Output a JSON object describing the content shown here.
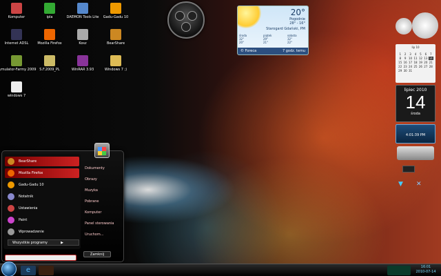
{
  "desktop_icons": [
    {
      "label": "Komputer",
      "color": "#c44",
      "x": 0,
      "y": 0
    },
    {
      "label": "ipla",
      "color": "#3a3",
      "x": 1,
      "y": 0
    },
    {
      "label": "DAEMON Tools Lite",
      "color": "#58c",
      "x": 2,
      "y": 0
    },
    {
      "label": "Gadu-Gadu 10",
      "color": "#e90",
      "x": 3,
      "y": 0
    },
    {
      "label": "Internet ADSL",
      "color": "#335",
      "x": 0,
      "y": 1
    },
    {
      "label": "Mozilla Firefox",
      "color": "#e60",
      "x": 1,
      "y": 1
    },
    {
      "label": "Kosz",
      "color": "#aaa",
      "x": 2,
      "y": 1
    },
    {
      "label": "BearShare",
      "color": "#c82",
      "x": 3,
      "y": 1
    },
    {
      "label": "Symulator-Farmy 2009",
      "color": "#793",
      "x": 0,
      "y": 2
    },
    {
      "label": "S.F.2009_PL",
      "color": "#cb6",
      "x": 1,
      "y": 2
    },
    {
      "label": "WinRAR 3.93",
      "color": "#839",
      "x": 2,
      "y": 2
    },
    {
      "label": "Windows 7 ;)",
      "color": "#db5",
      "x": 3,
      "y": 2
    },
    {
      "label": "windows 7",
      "color": "#eee",
      "x": 0,
      "y": 3
    }
  ],
  "weather": {
    "temp": "20°",
    "condition": "Pogodnie",
    "range": "28° - 16°",
    "location": "Starogard Gdański, PM",
    "days": [
      {
        "name": "środa",
        "hi": "32°",
        "lo": "20°"
      },
      {
        "name": "piątek",
        "hi": "29°",
        "lo": "21°"
      },
      {
        "name": "sobota",
        "hi": "32°",
        "lo": "22°"
      }
    ],
    "source": "© Foreca",
    "updated": "7 godz. temu"
  },
  "start_menu": {
    "items": [
      "BearShare",
      "Mozilla Firefox",
      "Gadu-Gadu 10",
      "Notatnik",
      "Ustawienia",
      "Paint",
      "Wprowadzenie"
    ],
    "all_programs": "Wszystkie programy",
    "right_items": [
      "Dokumenty",
      "Obrazy",
      "Muzyka",
      "Pobrane",
      "Komputer",
      "Panel sterowania",
      "Uruchom..."
    ],
    "shutdown": "Zamknij"
  },
  "calendar": {
    "month": "lip 10",
    "days": [
      "1",
      "2",
      "3",
      "4",
      "5",
      "6",
      "7",
      "8",
      "9",
      "10",
      "11",
      "12",
      "13",
      "14",
      "15",
      "16",
      "17",
      "18",
      "19",
      "20",
      "21",
      "22",
      "23",
      "24",
      "25",
      "26",
      "27",
      "28",
      "29",
      "30",
      "31"
    ],
    "today": "14"
  },
  "bigdate": {
    "month": "lipiec 2010",
    "day": "14",
    "weekday": "środa"
  },
  "timer": {
    "time": "4:01:39 PM"
  },
  "taskbar": {
    "time": "16:01",
    "date": "2010-07-14"
  }
}
